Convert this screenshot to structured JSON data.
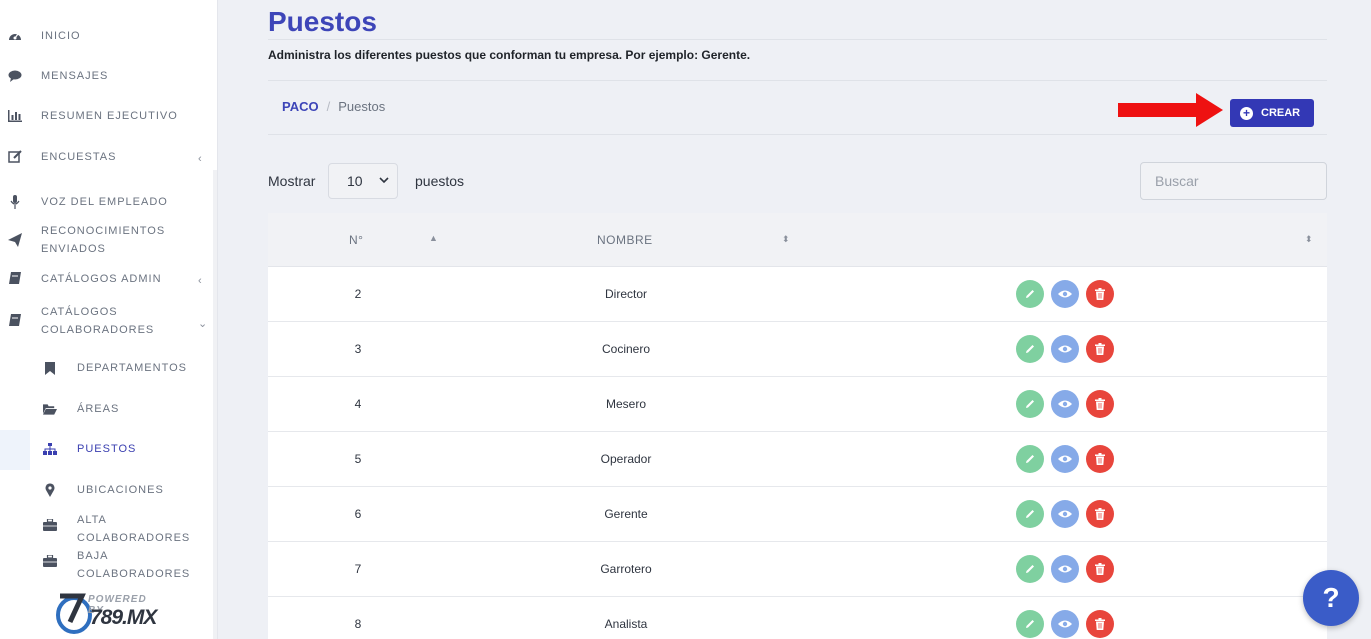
{
  "sidebar": {
    "items": [
      {
        "label": "INICIO",
        "icon": "dashboard-icon"
      },
      {
        "label": "MENSAJES",
        "icon": "chat-icon"
      },
      {
        "label": "RESUMEN EJECUTIVO",
        "icon": "bar-chart-icon"
      },
      {
        "label": "ENCUESTAS",
        "icon": "edit-icon",
        "expand": "‹"
      },
      {
        "label": "VOZ DEL EMPLEADO",
        "icon": "microphone-icon"
      },
      {
        "label": "RECONOCIMIENTOS",
        "label2": "ENVIADOS",
        "icon": "paper-plane-icon"
      },
      {
        "label": "CATÁLOGOS ADMIN",
        "icon": "book-icon",
        "expand": "‹"
      },
      {
        "label": "CATÁLOGOS",
        "label2": "COLABORADORES",
        "icon": "book-icon",
        "expand": "⌄"
      }
    ],
    "subitems": [
      {
        "label": "DEPARTAMENTOS",
        "icon": "bookmark-icon"
      },
      {
        "label": "ÁREAS",
        "icon": "folder-open-icon"
      },
      {
        "label": "PUESTOS",
        "icon": "sitemap-icon"
      },
      {
        "label": "UBICACIONES",
        "icon": "map-marker-icon"
      },
      {
        "label": "ALTA",
        "label2": "COLABORADORES",
        "icon": "briefcase-icon"
      },
      {
        "label": "BAJA",
        "label2": "COLABORADORES",
        "icon": "briefcase-icon"
      }
    ],
    "powered_top": "POWERED BY",
    "powered_main": "789.MX"
  },
  "header": {
    "title": "Puestos",
    "subtitle": "Administra los diferentes puestos que conforman tu empresa. Por ejemplo: Gerente."
  },
  "breadcrumb": {
    "home": "PACO",
    "separator": "/",
    "current": "Puestos"
  },
  "toolbar": {
    "create_label": "CREAR",
    "show_label": "Mostrar",
    "show_value": "10",
    "show_suffix": "puestos",
    "search_placeholder": "Buscar"
  },
  "table": {
    "headers": {
      "number": "N°",
      "name": "NOMBRE"
    },
    "rows": [
      {
        "num": "2",
        "name": "Director"
      },
      {
        "num": "3",
        "name": "Cocinero"
      },
      {
        "num": "4",
        "name": "Mesero"
      },
      {
        "num": "5",
        "name": "Operador"
      },
      {
        "num": "6",
        "name": "Gerente"
      },
      {
        "num": "7",
        "name": "Garrotero"
      },
      {
        "num": "8",
        "name": "Analista"
      }
    ]
  },
  "help_label": "?",
  "colors": {
    "accent": "#3d45b8",
    "edit": "#7fd0a0",
    "view": "#86aae8",
    "delete": "#e8453c",
    "arrow": "#ee1111"
  }
}
